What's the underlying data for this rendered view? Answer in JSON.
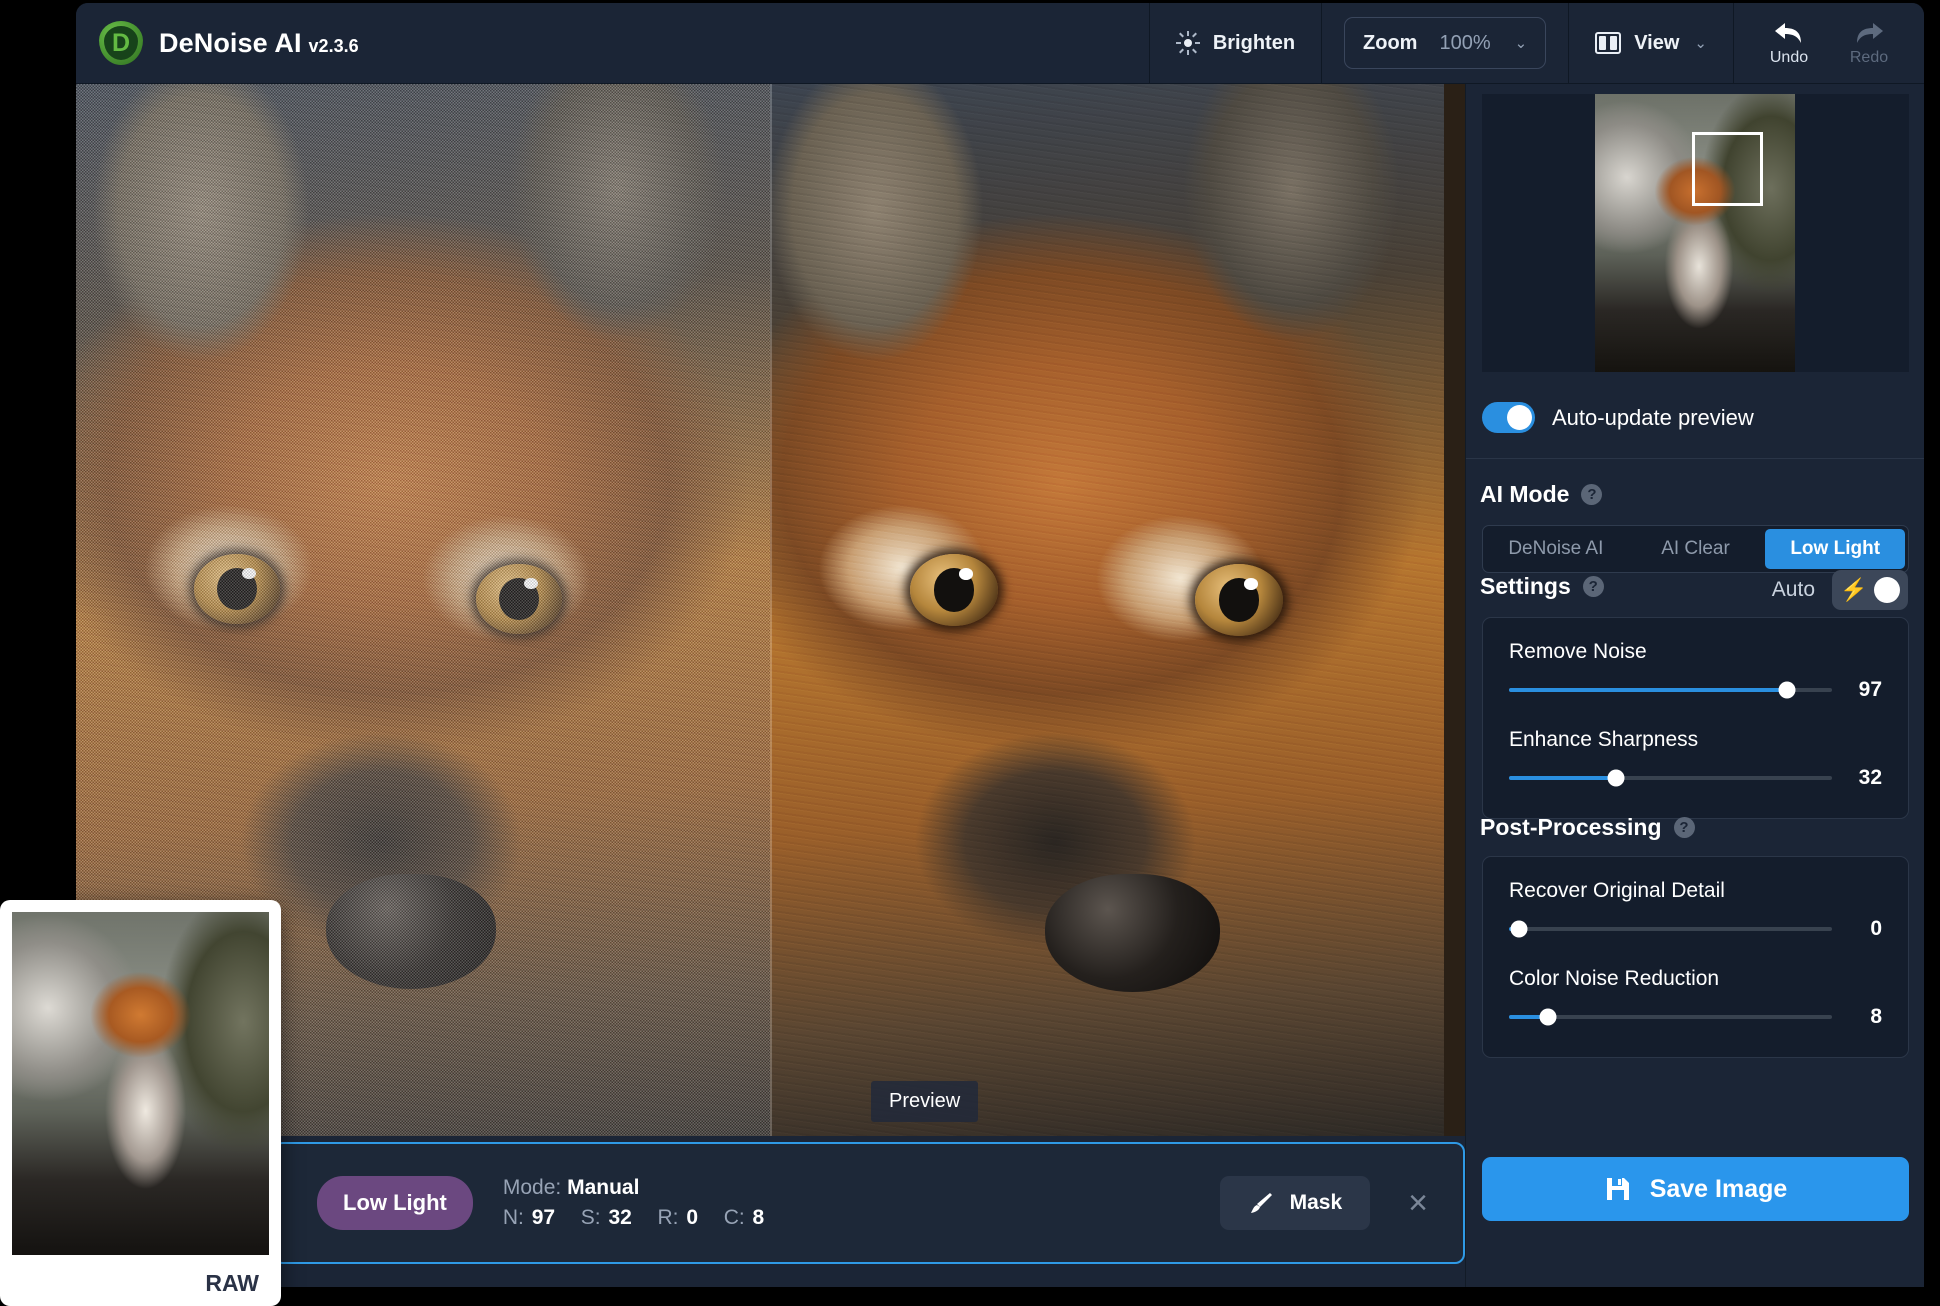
{
  "app": {
    "name": "DeNoise AI",
    "version": "v2.3.6",
    "logo_letter": "D"
  },
  "toolbar": {
    "brighten_label": "Brighten",
    "brighten_icon": "sun-icon",
    "zoom_label": "Zoom",
    "zoom_value": "100%",
    "zoom_chevron": "⌄",
    "view_label": "View",
    "view_icon": "split-view-icon",
    "view_chevron": "⌄",
    "undo_label": "Undo",
    "redo_label": "Redo"
  },
  "stage": {
    "preview_tag": "Preview",
    "left_pane_name": "original-noisy",
    "right_pane_name": "denoised-preview"
  },
  "statusbar": {
    "mode_pill": "Low Light",
    "mode_key": "Mode:",
    "mode_value": "Manual",
    "params": [
      {
        "key": "N:",
        "value": "97"
      },
      {
        "key": "S:",
        "value": "32"
      },
      {
        "key": "R:",
        "value": "0"
      },
      {
        "key": "C:",
        "value": "8"
      }
    ],
    "mask_label": "Mask",
    "mask_icon": "brush-icon",
    "close_icon": "×"
  },
  "sidebar": {
    "navigator": {
      "name": "navigator-thumbnail",
      "viewport_name": "navigator-viewport-rect"
    },
    "auto_update": {
      "label": "Auto-update preview",
      "state": "on"
    },
    "ai_mode": {
      "title": "AI Mode",
      "help": "?",
      "options": [
        {
          "label": "DeNoise AI",
          "active": false
        },
        {
          "label": "AI Clear",
          "active": false
        },
        {
          "label": "Low Light",
          "active": true
        }
      ]
    },
    "settings": {
      "title": "Settings",
      "help": "?",
      "auto_label": "Auto",
      "auto_state": "off",
      "bolt_icon": "⚡",
      "sliders": [
        {
          "label": "Remove Noise",
          "value": 97,
          "max": 100
        },
        {
          "label": "Enhance Sharpness",
          "value": 32,
          "max": 100
        }
      ]
    },
    "post_processing": {
      "title": "Post-Processing",
      "help": "?",
      "sliders": [
        {
          "label": "Recover Original Detail",
          "value": 0,
          "max": 100
        },
        {
          "label": "Color Noise Reduction",
          "value": 8,
          "max": 100
        }
      ]
    },
    "save_button": {
      "label": "Save Image",
      "icon": "save-disk-icon"
    }
  },
  "raw_thumbnail": {
    "badge": "RAW"
  },
  "colors": {
    "accent_blue": "#2a8fe0",
    "save_blue": "#2a96ec",
    "panel_bg": "#1b2536",
    "card_bg": "#141d2c",
    "mode_pill_purple": "#6b4880",
    "logo_green": "#63bb43"
  }
}
